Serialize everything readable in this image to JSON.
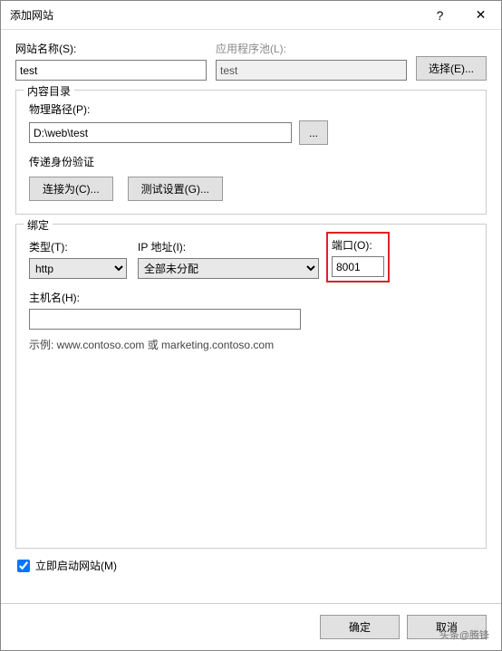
{
  "titlebar": {
    "title": "添加网站",
    "help_icon": "?",
    "close_icon": "✕"
  },
  "site": {
    "name_label": "网站名称(S):",
    "name_value": "test",
    "apppool_label": "应用程序池(L):",
    "apppool_value": "test",
    "select_button": "选择(E)..."
  },
  "content_dir": {
    "group_title": "内容目录",
    "path_label": "物理路径(P):",
    "path_value": "D:\\web\\test",
    "browse_button": "...",
    "passthru_label": "传递身份验证",
    "connect_as_button": "连接为(C)...",
    "test_settings_button": "测试设置(G)..."
  },
  "binding": {
    "group_title": "绑定",
    "type_label": "类型(T):",
    "type_value": "http",
    "ip_label": "IP 地址(I):",
    "ip_value": "全部未分配",
    "port_label": "端口(O):",
    "port_value": "8001",
    "host_label": "主机名(H):",
    "host_value": "",
    "example": "示例: www.contoso.com 或 marketing.contoso.com"
  },
  "autostart": {
    "label": "立即启动网站(M)",
    "checked": true
  },
  "footer": {
    "ok": "确定",
    "cancel": "取消"
  },
  "watermark": "头条@腾锋"
}
